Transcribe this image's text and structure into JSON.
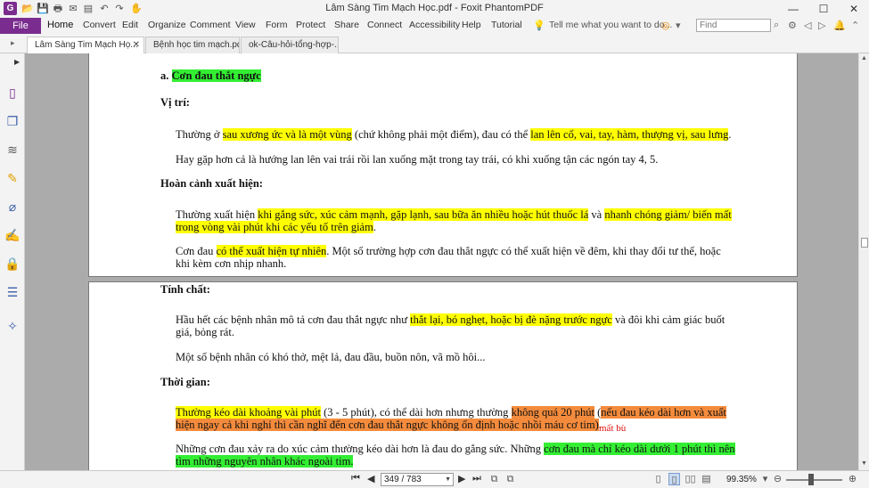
{
  "window": {
    "title": "Lâm Sàng Tim Mạch Học.pdf - Foxit PhantomPDF",
    "logo_letter": "G",
    "min_glyph": "—",
    "max_glyph": "☐",
    "close_glyph": "✕"
  },
  "quick_access": [
    {
      "name": "open-icon",
      "glyph": "📂"
    },
    {
      "name": "save-icon",
      "glyph": "💾"
    },
    {
      "name": "print-icon",
      "glyph": "🖶"
    },
    {
      "name": "email-icon",
      "glyph": "✉"
    },
    {
      "name": "form-icon",
      "glyph": "▤"
    },
    {
      "name": "undo-icon",
      "glyph": "↶"
    },
    {
      "name": "redo-icon",
      "glyph": "↷"
    },
    {
      "name": "hand-tool-icon",
      "glyph": "✋"
    }
  ],
  "menu": {
    "file": "File",
    "items": [
      "Home",
      "Convert",
      "Edit",
      "Organize",
      "Comment",
      "View",
      "Form",
      "Protect",
      "Share",
      "Connect",
      "Accessibility",
      "Help",
      "Tutorial"
    ],
    "active": "Home",
    "tell_me": "Tell me what you want to do...",
    "find_placeholder": "Find"
  },
  "tabs": [
    {
      "label": "Lâm Sàng Tim Mạch Họ...",
      "active": true
    },
    {
      "label": "Bệnh học tim mạch.pdf",
      "active": false
    },
    {
      "label": "ok-Câu-hỏi-tổng-hợp-...",
      "active": false
    }
  ],
  "left_panel_icons": [
    "bookmark-icon",
    "pages-icon",
    "layers-icon",
    "comments-icon",
    "attachments-icon",
    "signature-icon",
    "security-icon",
    "fields-icon",
    "certificate-icon"
  ],
  "document": {
    "page1": {
      "heading_prefix": "a.",
      "heading": "Cơn đau thắt ngực",
      "vitri_label": "Vị trí:",
      "p1_a": "Thường ở ",
      "p1_b": "sau xương ức và là một vùng",
      "p1_c": " (chứ không phải một điểm), đau có thể ",
      "p1_d": "lan lên cổ, vai, tay, hàm, thượng vị, sau lưng",
      "p1_e": ".",
      "p2": "Hay gặp hơn cả là hướng lan lên vai trái rồi lan xuống mặt trong tay trái, có khi xuống tận các ngón tay 4, 5.",
      "hoancanh_label": "Hoàn cảnh xuất hiện:",
      "p3_a": "Thường xuất hiện ",
      "p3_b": "khi gắng sức, xúc cảm mạnh, gặp lạnh, sau bữa ăn nhiều hoặc hút thuốc lá",
      "p3_c": " và ",
      "p3_d": "nhanh chóng giảm/ biến mất",
      "p3_e": "trong vòng vài phút khi các yếu tố trên giảm",
      "p3_f": ".",
      "p4_a": "Cơn đau ",
      "p4_b": "có thể xuất hiện tự nhiên",
      "p4_c": ". Một số trường hợp cơn đau thắt ngực có thể xuất hiện về đêm, khi thay đổi tư thế, hoặc",
      "p4_d": "khi kèm cơn nhịp nhanh."
    },
    "page2": {
      "tinhchat_label": "Tính chất:",
      "p1_a": "Hầu hết các bệnh nhân mô tả cơn đau thắt ngực như ",
      "p1_b": "thắt lại, bó nghẹt, hoặc bị đè nặng trước ngực",
      "p1_c": " và đôi khi cảm giác buốt",
      "p1_d": "giá, bỏng rát.",
      "p2": "Một số bệnh nhân có khó thở, mệt lả, đau đầu, buồn nôn, vã mồ hôi...",
      "thoigian_label": "Thời gian:",
      "p3_a": "Thường kéo dài khoảng vài phút",
      "p3_b": " (3 - 5 phút), có thể dài hơn nhưng thường ",
      "p3_c": "không quá 20 phút",
      "p3_d": " (",
      "p3_e": "nếu đau kéo dài hơn và xuất",
      "p3_f": "hiện ngay cả khi nghỉ thì cần nghĩ đến cơn đau thắt ngực không ổn định hoặc nhồi máu cơ tim)",
      "p3_g": ".",
      "note": "mất bù",
      "p4_a": "Những cơn đau xảy ra do xúc cảm thường kéo dài hơn là đau do gắng sức. Những ",
      "p4_b": "cơn đau mà chỉ kéo dài dưới 1 phút thì nên",
      "p4_c": "tìm những nguyên nhân khác ngoài tim."
    }
  },
  "status": {
    "page_field": "349 / 783",
    "zoom": "99.35%",
    "nav": {
      "first": "⏮",
      "prev": "◀",
      "next": "▶",
      "last": "⏭"
    },
    "zoom_out": "⊖",
    "zoom_in": "⊕",
    "zoom_fraction": 0.45
  },
  "colors": {
    "brand": "#7b2d8f",
    "highlight_yellow": "#ffff00",
    "highlight_green": "#33ee33",
    "highlight_orange": "#f48b3c",
    "note_red": "#e01010"
  }
}
